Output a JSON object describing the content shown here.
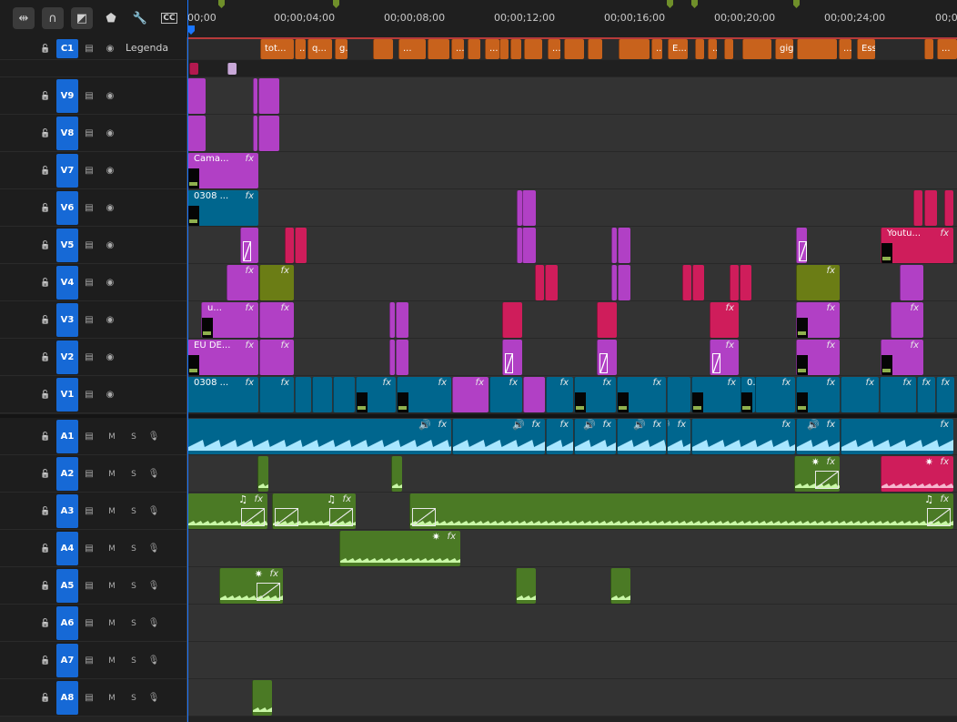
{
  "timecodes": [
    "00;00",
    "00;00;04;00",
    "00;00;08;00",
    "00;00;12;00",
    "00;00;16;00",
    "00;00;20;00",
    "00;00;24;00",
    "00;0"
  ],
  "toolbar": [
    {
      "name": "snap-ripple-tool-button",
      "glyph": "⇹",
      "active": true
    },
    {
      "name": "magnet-snap-button",
      "glyph": "∩",
      "active": true
    },
    {
      "name": "linked-selection-button",
      "glyph": "◩",
      "active": true
    },
    {
      "name": "add-marker-button",
      "glyph": "⬟",
      "active": false
    },
    {
      "name": "wrench-settings-button",
      "glyph": "🔧",
      "active": false
    },
    {
      "name": "captions-button",
      "glyph": "CC",
      "active": false
    }
  ],
  "caption_track": {
    "id": "C1",
    "label": "Legenda"
  },
  "caption_clips": [
    "tot...",
    "...",
    "q...",
    "g...",
    "...",
    "...",
    "...",
    "...",
    "...",
    "E...",
    "...",
    "gig...",
    "...",
    "Esse...",
    "...",
    "..."
  ],
  "video_tracks": [
    {
      "id": "V9"
    },
    {
      "id": "V8"
    },
    {
      "id": "V7"
    },
    {
      "id": "V6"
    },
    {
      "id": "V5"
    },
    {
      "id": "V4"
    },
    {
      "id": "V3"
    },
    {
      "id": "V2"
    },
    {
      "id": "V1"
    }
  ],
  "audio_tracks": [
    {
      "id": "A1",
      "m": "M",
      "s": "S"
    },
    {
      "id": "A2",
      "m": "M",
      "s": "S"
    },
    {
      "id": "A3",
      "m": "M",
      "s": "S"
    },
    {
      "id": "A4",
      "m": "M",
      "s": "S"
    },
    {
      "id": "A5",
      "m": "M",
      "s": "S"
    },
    {
      "id": "A6",
      "m": "M",
      "s": "S"
    },
    {
      "id": "A7",
      "m": "M",
      "s": "S"
    },
    {
      "id": "A8",
      "m": "M",
      "s": "S"
    }
  ],
  "clip_labels": {
    "v7_clip": "Cama...",
    "v6_clip": "0308 ...",
    "v5_clip": "Youtu...",
    "v3_clip": "u...",
    "v2_clip": "EU DE...",
    "v1_clip": "0308 ...",
    "v1_clip_b": "0...",
    "fx": "fx"
  },
  "colors": {
    "magenta": "#b140c5",
    "teal": "#00668e",
    "red": "#cf1d5b",
    "olive": "#6b7d15",
    "green": "#4b7a25",
    "caption": "#c8621c",
    "accent": "#1669d6"
  }
}
